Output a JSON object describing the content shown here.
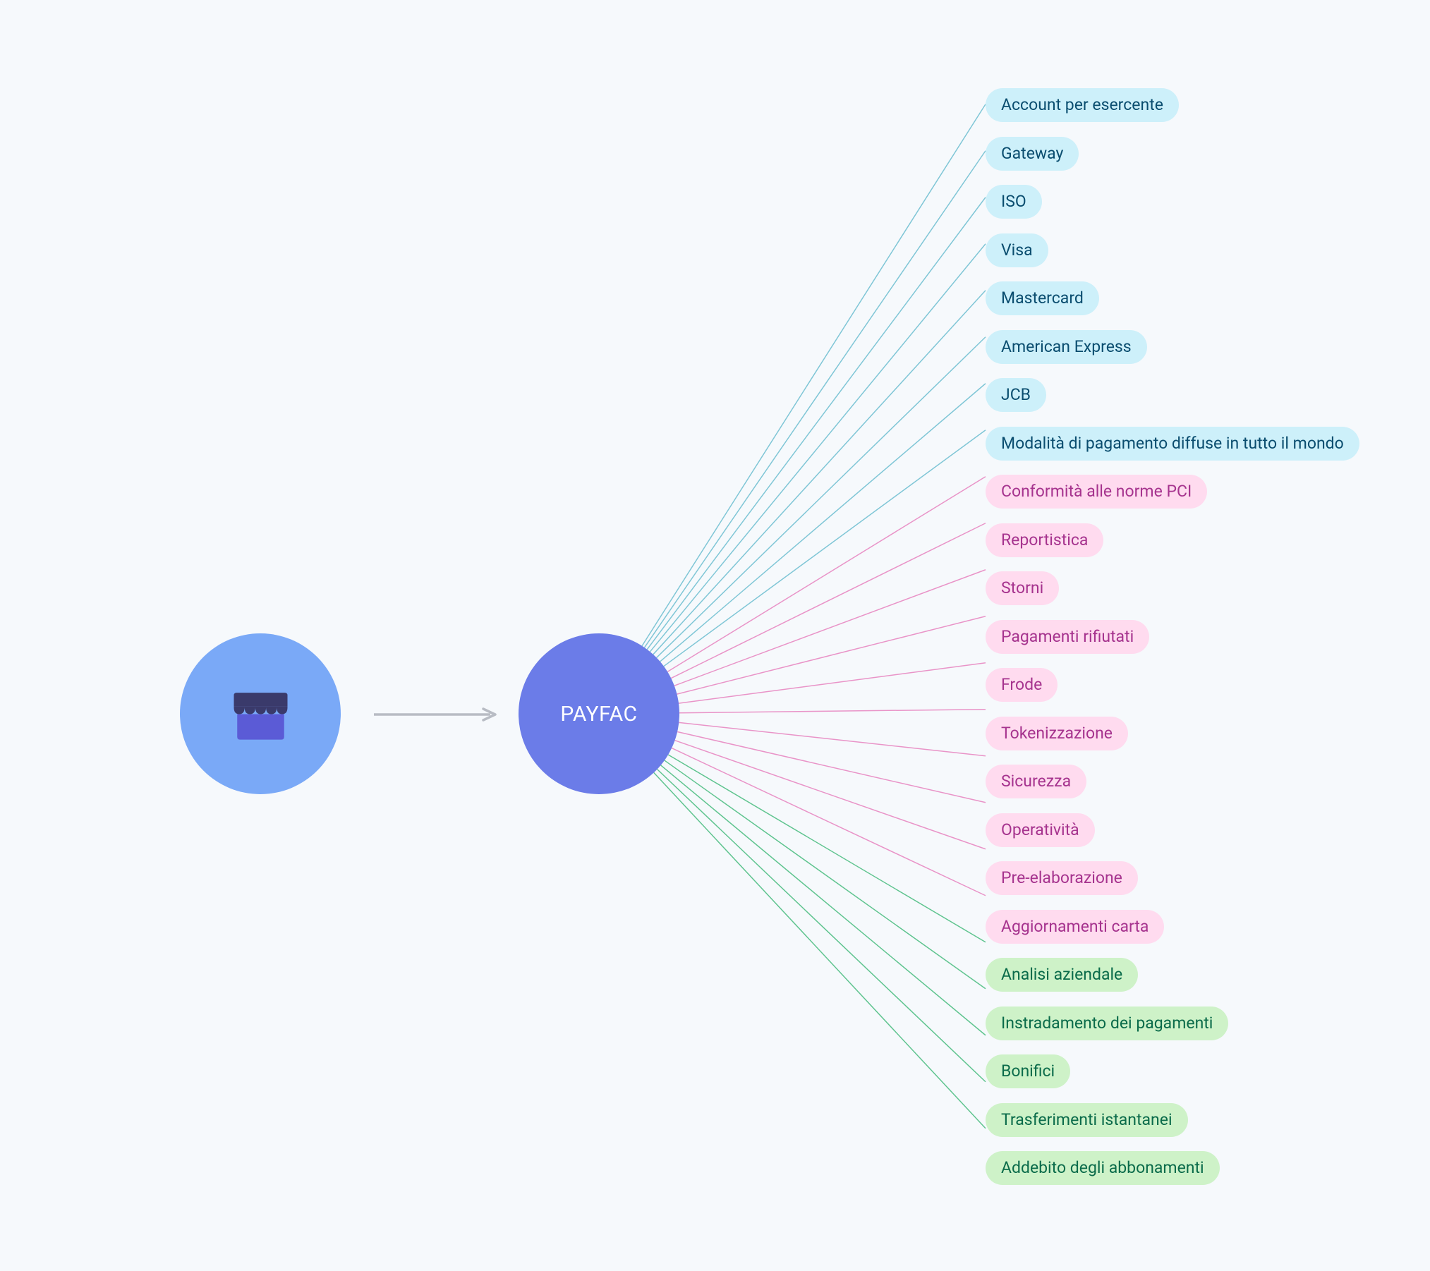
{
  "merchant_label": "Merchant",
  "payfac_label": "PAYFAC",
  "groups": {
    "blue": {
      "line_color": "#7fc6d6",
      "items": [
        "Account per esercente",
        "Gateway",
        "ISO",
        "Visa",
        "Mastercard",
        "American Express",
        "JCB",
        "Modalità di pagamento diffuse in tutto il mondo"
      ]
    },
    "pink": {
      "line_color": "#e994c8",
      "items": [
        "Conformità alle norme PCI",
        "Reportistica",
        "Storni",
        "Pagamenti rifiutati",
        "Frode",
        "Tokenizzazione",
        "Sicurezza",
        "Operatività",
        "Pre-elaborazione",
        "Aggiornamenti carta"
      ]
    },
    "green": {
      "line_color": "#5fc48f",
      "items": [
        "Analisi aziendale",
        "Instradamento dei pagamenti",
        "Bonifici",
        "Trasferimenti istantanei",
        "Addebito degli abbonamenti"
      ]
    }
  }
}
